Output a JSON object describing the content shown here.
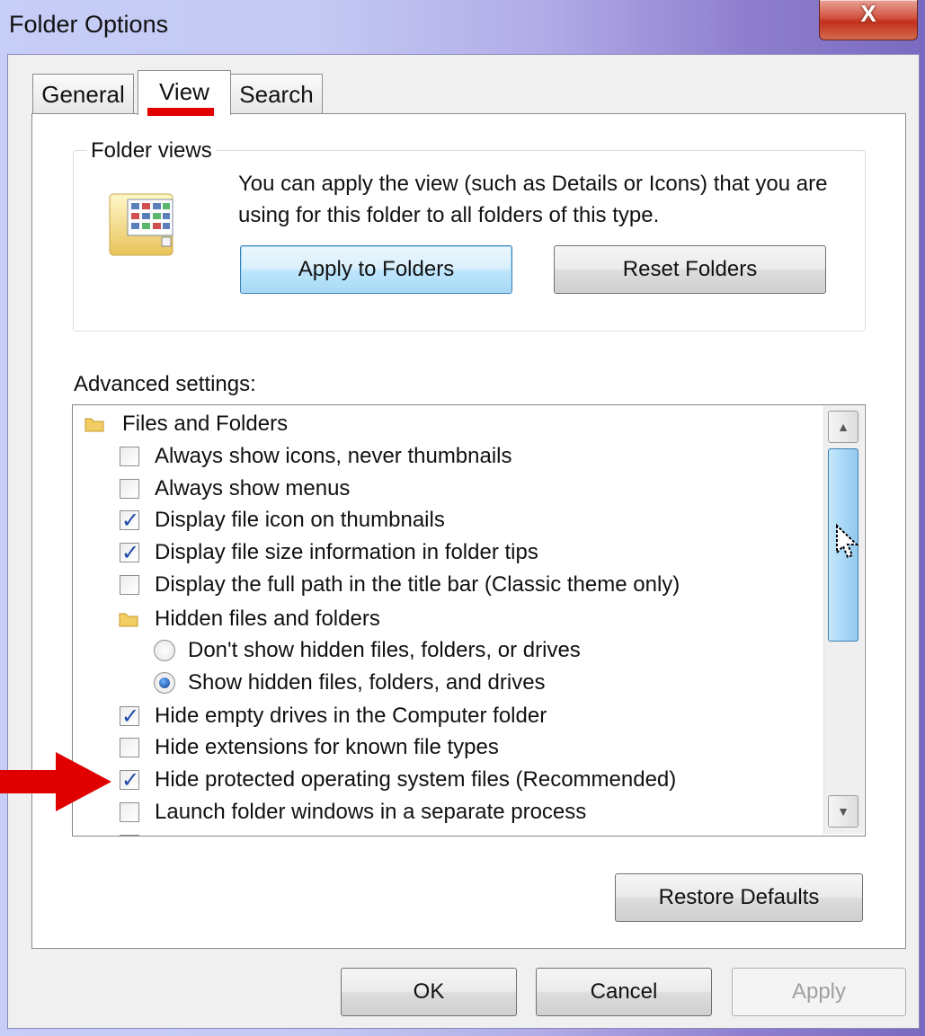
{
  "window": {
    "title": "Folder Options",
    "close_glyph": "X"
  },
  "tabs": [
    {
      "label": "General",
      "active": false
    },
    {
      "label": "View",
      "active": true
    },
    {
      "label": "Search",
      "active": false
    }
  ],
  "folder_views": {
    "legend": "Folder views",
    "description": "You can apply the view (such as Details or Icons) that you are using for this folder to all folders of this type.",
    "apply_button": "Apply to Folders",
    "reset_button": "Reset Folders"
  },
  "advanced": {
    "label": "Advanced settings:",
    "items": [
      {
        "kind": "folder",
        "label": "Files and Folders"
      },
      {
        "kind": "checkbox",
        "label": "Always show icons, never thumbnails",
        "checked": false
      },
      {
        "kind": "checkbox",
        "label": "Always show menus",
        "checked": false
      },
      {
        "kind": "checkbox",
        "label": "Display file icon on thumbnails",
        "checked": true
      },
      {
        "kind": "checkbox",
        "label": "Display file size information in folder tips",
        "checked": true
      },
      {
        "kind": "checkbox",
        "label": "Display the full path in the title bar (Classic theme only)",
        "checked": false
      },
      {
        "kind": "folder",
        "label": "Hidden files and folders"
      },
      {
        "kind": "radio",
        "label": "Don't show hidden files, folders, or drives",
        "selected": false
      },
      {
        "kind": "radio",
        "label": "Show hidden files, folders, and drives",
        "selected": true
      },
      {
        "kind": "checkbox",
        "label": "Hide empty drives in the Computer folder",
        "checked": true
      },
      {
        "kind": "checkbox",
        "label": "Hide extensions for known file types",
        "checked": false
      },
      {
        "kind": "checkbox",
        "label": "Hide protected operating system files (Recommended)",
        "checked": true
      },
      {
        "kind": "checkbox",
        "label": "Launch folder windows in a separate process",
        "checked": false
      }
    ],
    "check_glyph": "✓"
  },
  "restore_defaults": "Restore Defaults",
  "footer": {
    "ok": "OK",
    "cancel": "Cancel",
    "apply": "Apply"
  },
  "colors": {
    "annotation_red": "#e00000",
    "accent_blue": "#3c7fb1"
  },
  "icons": [
    "close-icon",
    "folder-view-icon",
    "folder-icon",
    "scroll-up-icon",
    "scroll-down-icon",
    "mouse-cursor-icon",
    "red-arrow-annotation"
  ]
}
